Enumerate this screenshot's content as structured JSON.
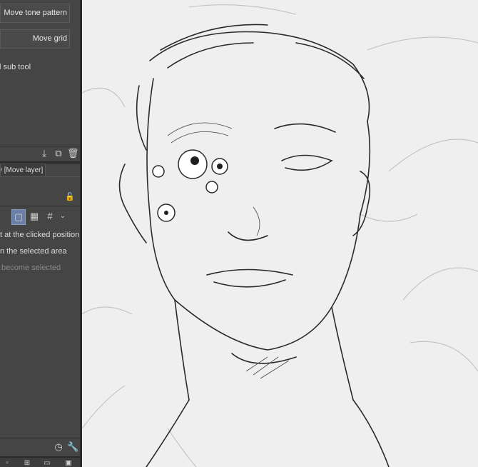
{
  "tool_property": {
    "move_tone_pattern_label": "Move tone pattern",
    "move_grid_label": "Move grid",
    "sub_tool_text": "l sub tool",
    "tab_label": "y [Move layer]",
    "options": [
      {
        "text": "t at the clicked position",
        "enabled": true
      },
      {
        "text": "n the selected area",
        "enabled": true
      },
      {
        "text": "become selected",
        "enabled": false
      }
    ]
  },
  "icons": {
    "add_preset": "import-icon",
    "duplicate": "duplicate-icon",
    "delete": "trash-icon",
    "lock": "lock-icon",
    "mode_normal": "square-select-icon",
    "mode_tone": "checker-icon",
    "mode_grid": "grid-icon",
    "mode_dropdown": "chevron-down-icon",
    "reset": "reset-icon",
    "settings": "wrench-icon"
  },
  "colors": {
    "panel_bg": "#454545",
    "canvas_bg": "#efefef",
    "selected_mode": "#6c7fa8"
  }
}
